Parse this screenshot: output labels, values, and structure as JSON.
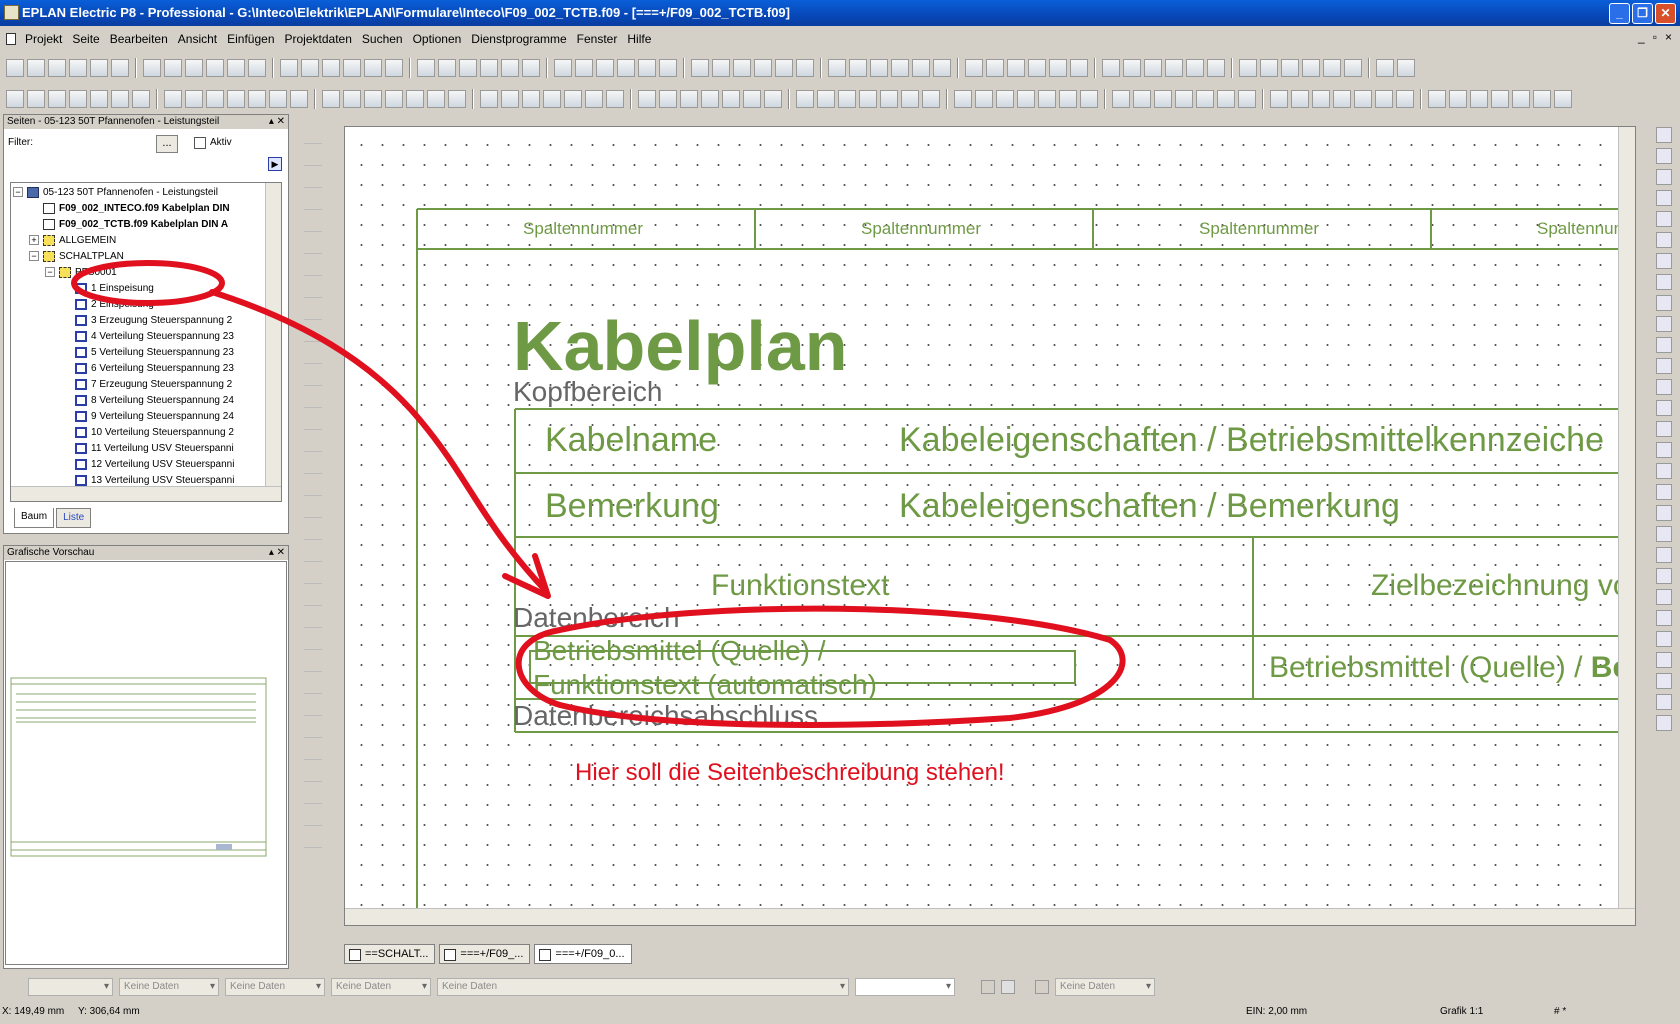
{
  "window": {
    "title": "EPLAN Electric P8 - Professional - G:\\Inteco\\Elektrik\\EPLAN\\Formulare\\Inteco\\F09_002_TCTB.f09 - [===+/F09_002_TCTB.f09]",
    "min": "_",
    "max": "❐",
    "close": "✕"
  },
  "menu": [
    "Projekt",
    "Seite",
    "Bearbeiten",
    "Ansicht",
    "Einfügen",
    "Projektdaten",
    "Suchen",
    "Optionen",
    "Dienstprogramme",
    "Fenster",
    "Hilfe"
  ],
  "menu_right": [
    "_",
    "▫",
    "×"
  ],
  "pages_panel": {
    "title": "Seiten - 05-123 50T Pfannenofen - Leistungsteil",
    "filter_label": "Filter:",
    "filter_button": "...",
    "aktiv_label": "Aktiv",
    "tree": [
      {
        "text": "05-123 50T Pfannenofen - Leistungsteil",
        "indent": 0,
        "node": "−",
        "icon": "proj",
        "bold": false
      },
      {
        "text": "F09_002_INTECO.f09 Kabelplan DIN",
        "indent": 1,
        "node": "",
        "icon": "page",
        "bold": true
      },
      {
        "text": "F09_002_TCTB.f09 Kabelplan DIN A",
        "indent": 1,
        "node": "",
        "icon": "page",
        "bold": true
      },
      {
        "text": "ALLGEMEIN",
        "indent": 1,
        "node": "+",
        "icon": "fold",
        "bold": false
      },
      {
        "text": "SCHALTPLAN",
        "indent": 1,
        "node": "−",
        "icon": "fold",
        "bold": false
      },
      {
        "text": "PFS0001",
        "indent": 2,
        "node": "−",
        "icon": "fold",
        "bold": false
      },
      {
        "text": "1 Einspeisung",
        "indent": 3,
        "node": "",
        "icon": "sch",
        "bold": false
      },
      {
        "text": "2 Einspeisung",
        "indent": 3,
        "node": "",
        "icon": "sch",
        "bold": false
      },
      {
        "text": "3 Erzeugung Steuerspannung 2",
        "indent": 3,
        "node": "",
        "icon": "sch",
        "bold": false
      },
      {
        "text": "4 Verteilung Steuerspannung 23",
        "indent": 3,
        "node": "",
        "icon": "sch",
        "bold": false
      },
      {
        "text": "5 Verteilung Steuerspannung 23",
        "indent": 3,
        "node": "",
        "icon": "sch",
        "bold": false
      },
      {
        "text": "6 Verteilung Steuerspannung 23",
        "indent": 3,
        "node": "",
        "icon": "sch",
        "bold": false
      },
      {
        "text": "7 Erzeugung Steuerspannung 2",
        "indent": 3,
        "node": "",
        "icon": "sch",
        "bold": false
      },
      {
        "text": "8 Verteilung Steuerspannung 24",
        "indent": 3,
        "node": "",
        "icon": "sch",
        "bold": false
      },
      {
        "text": "9 Verteilung Steuerspannung 24",
        "indent": 3,
        "node": "",
        "icon": "sch",
        "bold": false
      },
      {
        "text": "10 Verteilung Steuerspannung 2",
        "indent": 3,
        "node": "",
        "icon": "sch",
        "bold": false
      },
      {
        "text": "11 Verteilung USV Steuerspanni",
        "indent": 3,
        "node": "",
        "icon": "sch",
        "bold": false
      },
      {
        "text": "12 Verteilung USV Steuerspanni",
        "indent": 3,
        "node": "",
        "icon": "sch",
        "bold": false
      },
      {
        "text": "13 Verteilung USV Steuerspanni",
        "indent": 3,
        "node": "",
        "icon": "sch",
        "bold": false
      }
    ],
    "tabs": [
      "Baum",
      "Liste"
    ]
  },
  "preview_panel": {
    "title": "Grafische Vorschau"
  },
  "drawing": {
    "column_header": "Spaltennummer",
    "title": "Kabelplan",
    "kopfbereich": "Kopfbereich",
    "kabelname": "Kabelname",
    "kabeleigenschaften_bmk": "Kabeleigenschaften / Betriebsmittelkennzeiche",
    "bemerkung": "Bemerkung",
    "kabeleigenschaften_bemerkung": "Kabeleigenschaften / Bemerkung",
    "funktionstext": "Funktionstext",
    "zielbezeichnung": "Zielbezeichnung vo",
    "datenbereich": "Datenbereich",
    "bm_quelle_line1": "Betriebsmittel (Quelle) /",
    "bm_quelle_line2": "Funktionstext (automatisch)",
    "bm_quelle_right": "Betriebsmittel (Quelle) /",
    "bm_quelle_right_bold": "Be",
    "datenbereichsabschluss": "Datenbereichsabschluss",
    "annotation": "Hier soll die Seitenbeschreibung stehen!",
    "drawing_color": "#6f9a45",
    "annotation_color": "#e0101e"
  },
  "doc_tabs": [
    "==SCHALT...",
    "===+/F09_...",
    "===+/F09_0..."
  ],
  "combos": [
    "",
    "Keine Daten",
    "Keine Daten",
    "Keine Daten",
    "Keine Daten",
    "Keine Daten"
  ],
  "status": {
    "x": "X: 149,49 mm",
    "y": "Y: 306,64 mm",
    "ein": "EIN: 2,00 mm",
    "grafik": "Grafik 1:1",
    "hash": "# *"
  }
}
